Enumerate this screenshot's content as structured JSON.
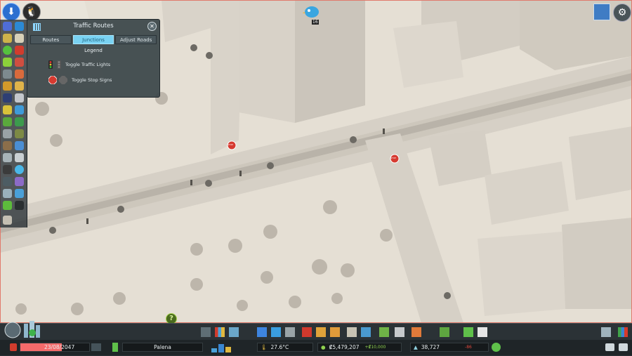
{
  "window": {
    "title": "Traffic Routes"
  },
  "panel": {
    "title": "Traffic Routes",
    "tabs": [
      {
        "label": "Routes",
        "active": false
      },
      {
        "label": "Junctions",
        "active": true
      },
      {
        "label": "Adjust Roads",
        "active": false
      }
    ],
    "legend_title": "Legend",
    "legend_items": [
      {
        "label": "Toggle Traffic Lights",
        "icon": "traffic-light-icon"
      },
      {
        "label": "Toggle Stop Signs",
        "icon": "stop-sign-icon"
      }
    ]
  },
  "map": {
    "chirper_badge": "16",
    "stop_sign_text": "STOP"
  },
  "status": {
    "date": "23/08/2047",
    "city_name": "Palena",
    "temperature": "27.6°C",
    "money": "₡5,479,207",
    "income": "+₡10,000",
    "population": "38,727",
    "population_change": "-86"
  },
  "colors": {
    "accent": "#79d2f2",
    "panel_bg": "#3a4448",
    "money_green": "#8fd14f",
    "negative_red": "#e0483d"
  }
}
